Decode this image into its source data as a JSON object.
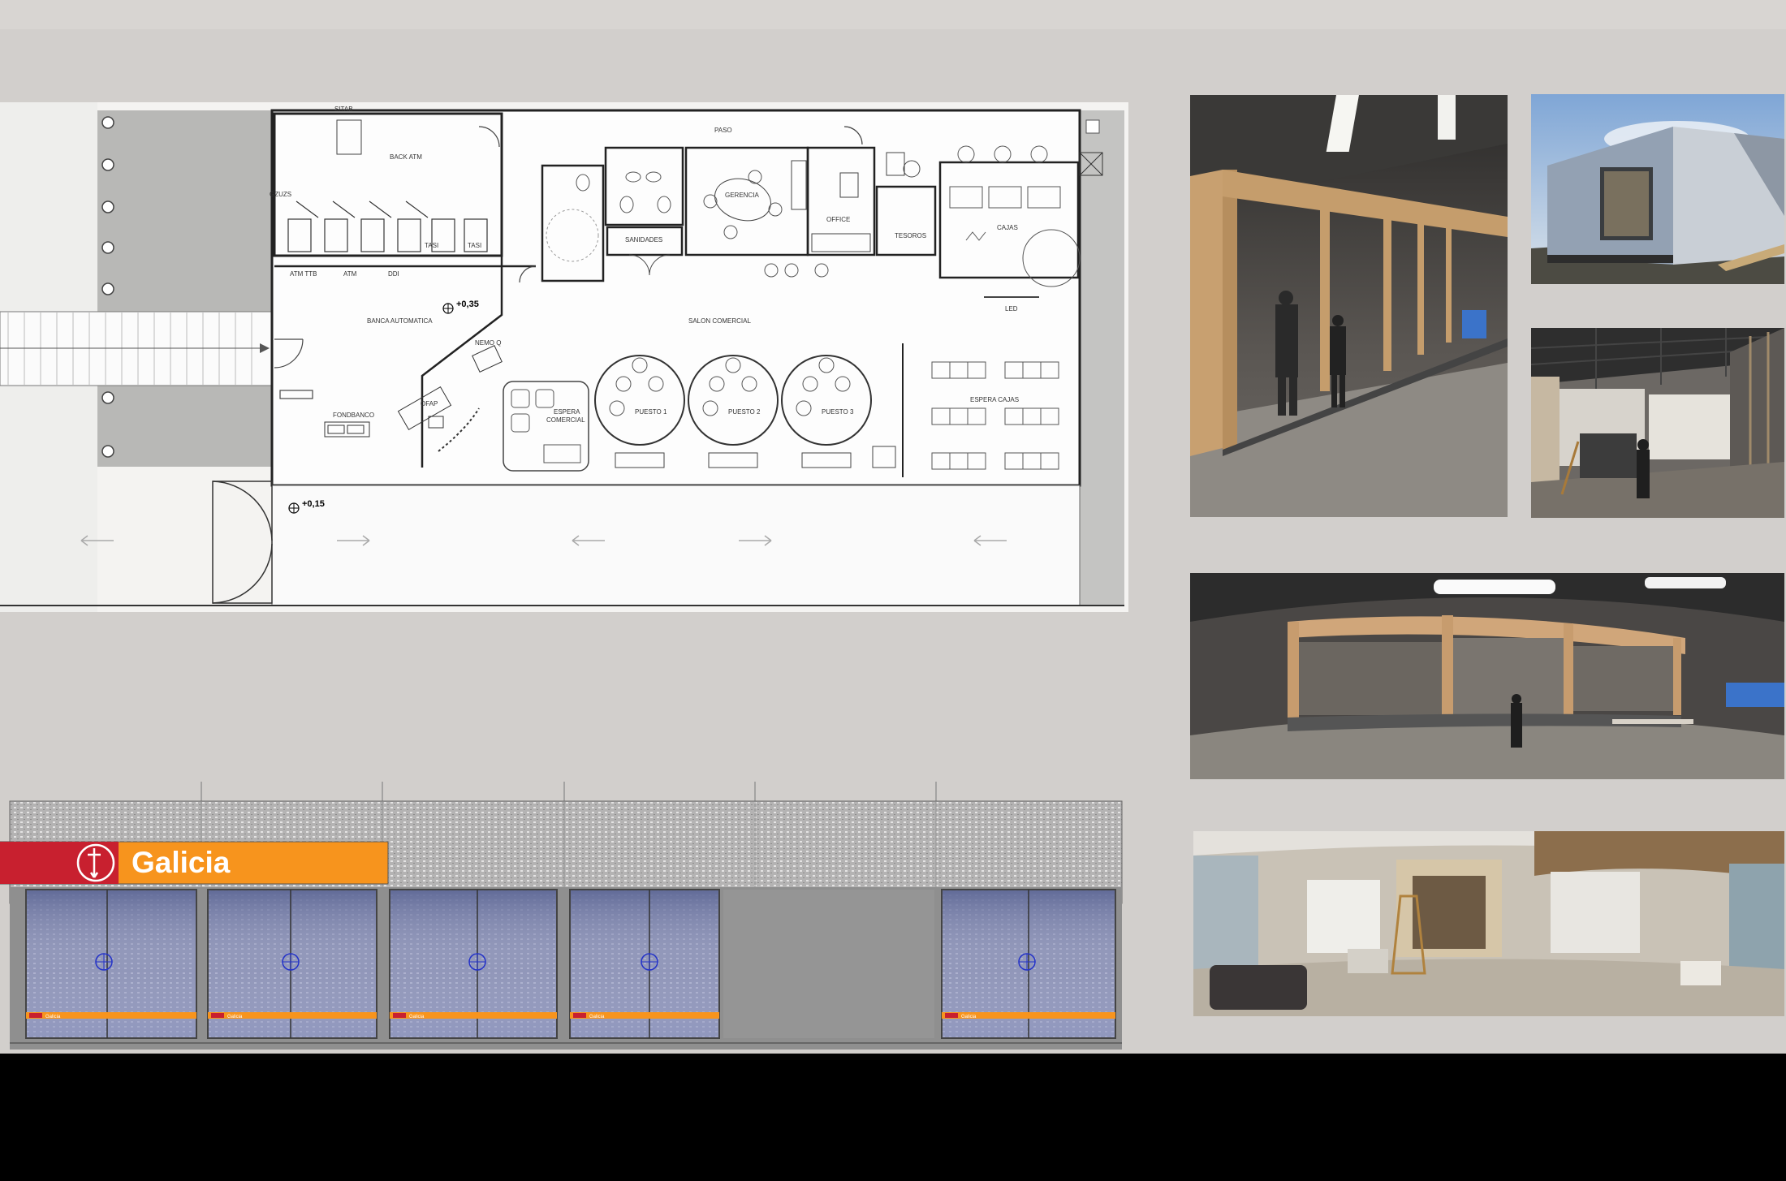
{
  "floor_plan": {
    "rooms": {
      "sitab": "SITAB",
      "back_atm": "BACK ATM",
      "gzuzs": "GZUZS",
      "tasi_1": "TASI",
      "tasi_2": "TASI",
      "atm_ttb": "ATM  TTB",
      "atm": "ATM",
      "ddi": "DDI",
      "banca_automatica": "BANCA AUTOMATICA",
      "nemo_q": "NEMO Q",
      "ofap": "OFAP",
      "fondbanco": "FONDBANCO",
      "sanitarios": "SANIDADES",
      "gerencia": "GERENCIA",
      "office": "OFFICE",
      "tesoros": "TESOROS",
      "cajas": "CAJAS",
      "pasillo": "PASO",
      "led": "LED",
      "salon_comercial": "SALON COMERCIAL",
      "espera_comercial": "ESPERA\nCOMERCIAL",
      "espera_comercial_line1": "ESPERA",
      "espera_comercial_line2": "COMERCIAL",
      "puesto_1": "PUESTO 1",
      "puesto_2": "PUESTO 2",
      "puesto_3": "PUESTO 3",
      "espera_cajas": "ESPERA CAJAS"
    },
    "levels": {
      "interior": "+0,35",
      "exterior": "+0,15"
    }
  },
  "elevation": {
    "brand_name": "Galicia",
    "vinyl_brand": "Galicia",
    "brand_color": "#f7941d",
    "brand_red": "#c8202f"
  },
  "photos": [
    {
      "name": "construction-photo-frame-interior"
    },
    {
      "name": "construction-photo-module-exterior"
    },
    {
      "name": "construction-photo-module-inside"
    },
    {
      "name": "construction-photo-panorama-warehouse"
    },
    {
      "name": "construction-photo-panorama-finished"
    }
  ]
}
